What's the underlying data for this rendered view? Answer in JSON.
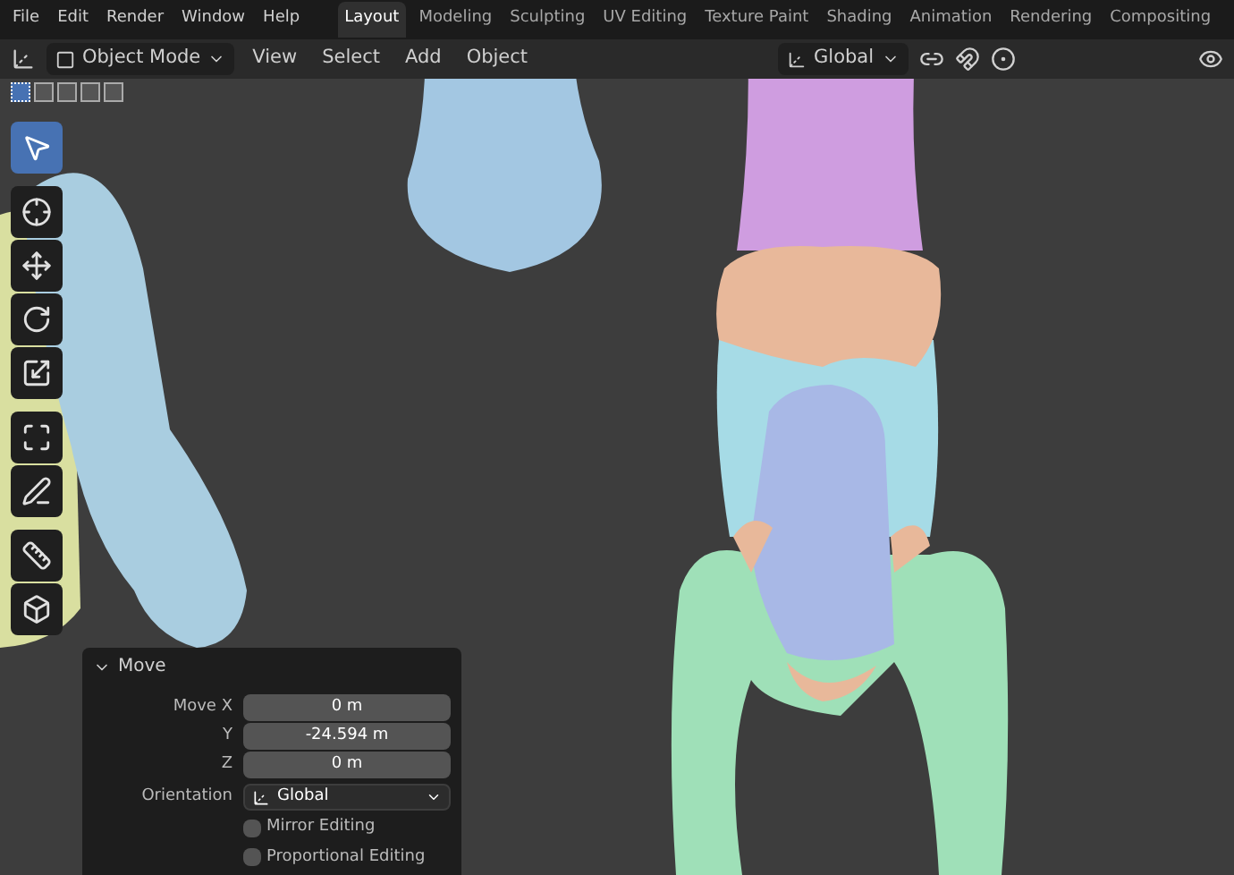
{
  "menu": [
    "File",
    "Edit",
    "Render",
    "Window",
    "Help"
  ],
  "workspaces": [
    {
      "label": "Layout",
      "selected": true
    },
    {
      "label": "Modeling",
      "selected": false
    },
    {
      "label": "Sculpting",
      "selected": false
    },
    {
      "label": "UV Editing",
      "selected": false
    },
    {
      "label": "Texture Paint",
      "selected": false
    },
    {
      "label": "Shading",
      "selected": false
    },
    {
      "label": "Animation",
      "selected": false
    },
    {
      "label": "Rendering",
      "selected": false
    },
    {
      "label": "Compositing",
      "selected": false
    }
  ],
  "header": {
    "mode": "Object Mode",
    "menus": [
      "View",
      "Select",
      "Add",
      "Object"
    ],
    "orientation": "Global"
  },
  "selection_modes": [
    {
      "selected": true
    },
    {
      "selected": false
    },
    {
      "selected": false
    },
    {
      "selected": false
    },
    {
      "selected": false
    }
  ],
  "tools": [
    {
      "kind": "select",
      "selected": true
    },
    {
      "kind": "cursor",
      "selected": false
    },
    {
      "kind": "move",
      "selected": false
    },
    {
      "kind": "rotate",
      "selected": false
    },
    {
      "kind": "scale",
      "selected": false
    },
    {
      "kind": "transform",
      "selected": false
    },
    {
      "kind": "annotate",
      "selected": false
    },
    {
      "kind": "measure",
      "selected": false
    },
    {
      "kind": "add",
      "selected": false
    }
  ],
  "operator_panel": {
    "title": "Move",
    "fields": [
      {
        "label": "Move X",
        "value": "0 m"
      },
      {
        "label": "Y",
        "value": "-24.594 m"
      },
      {
        "label": "Z",
        "value": "0 m"
      }
    ],
    "orientation": {
      "label": "Orientation",
      "value": "Global"
    },
    "options": [
      {
        "label": "Mirror Editing",
        "checked": false
      },
      {
        "label": "Proportional Editing",
        "checked": false
      }
    ]
  }
}
